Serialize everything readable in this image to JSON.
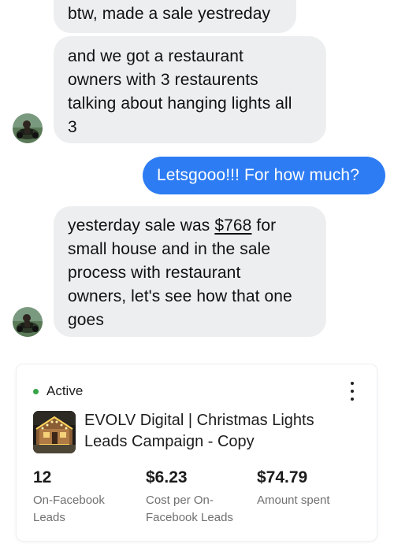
{
  "messages": [
    {
      "direction": "incoming",
      "text": "btw, made a sale yestreday"
    },
    {
      "direction": "incoming",
      "lines": [
        "and we got a restaurant",
        "owners with 3 restaurents",
        "talking about hanging lights all",
        "3"
      ]
    },
    {
      "direction": "outgoing",
      "text": "Letsgooo!!! For how much?"
    },
    {
      "direction": "incoming",
      "line_1_prefix": "yesterday sale was ",
      "line_1_link": "$768",
      "line_1_suffix": " for",
      "lines_after": [
        "small house and in the sale",
        "process with restaurant",
        "owners, let's see how that one",
        "goes"
      ]
    }
  ],
  "campaign_card": {
    "status": "Active",
    "status_color": "#36a447",
    "menu_icon": "more-vertical-icon",
    "thumbnail": "christmas-lights-house-image",
    "title_lines": [
      "EVOLV Digital | Christmas Lights",
      "Leads Campaign - Copy"
    ],
    "metrics": [
      {
        "value": "12",
        "label_lines": [
          "On-Facebook",
          "Leads"
        ]
      },
      {
        "value": "$6.23",
        "label_lines": [
          "Cost per On-",
          "Facebook Leads"
        ]
      },
      {
        "value": "$74.79",
        "label_lines": [
          "Amount spent"
        ]
      }
    ]
  },
  "colors": {
    "incoming_bubble": "#eceef0",
    "outgoing_bubble": "#2d7cf4",
    "outgoing_text": "#ffffff",
    "metric_label": "#707070"
  }
}
